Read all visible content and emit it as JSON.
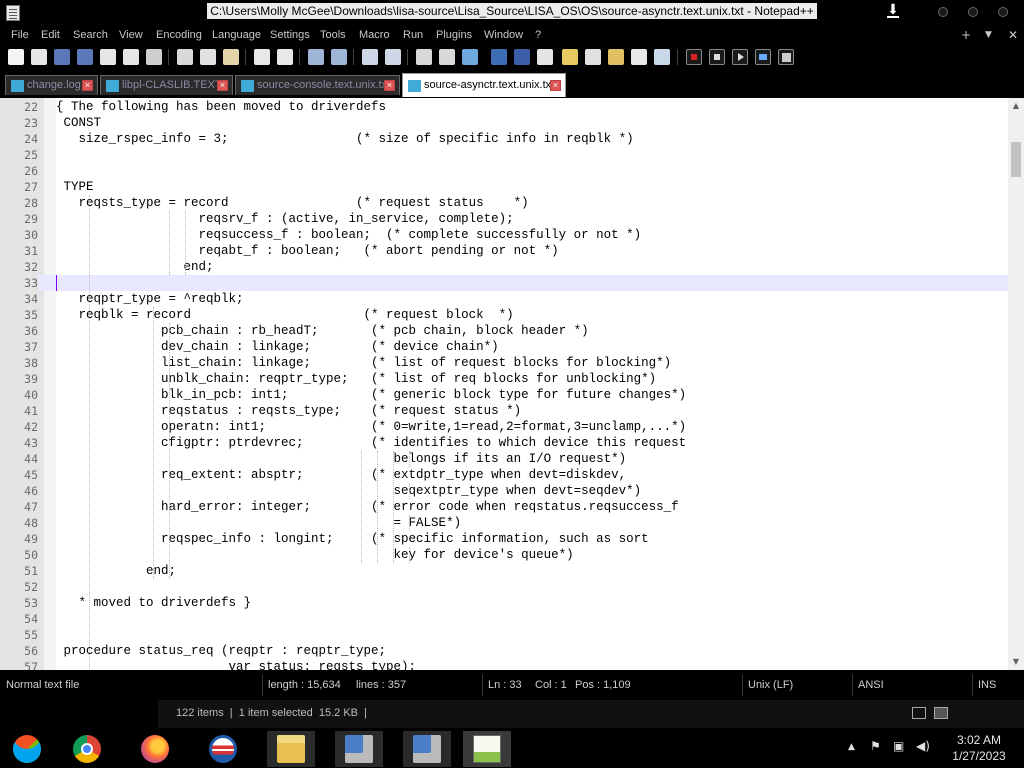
{
  "window": {
    "title": "C:\\Users\\Molly McGee\\Downloads\\lisa-source\\Lisa_Source\\LISA_OS\\OS\\source-asynctr.text.unix.txt - Notepad++"
  },
  "menu": [
    "File",
    "Edit",
    "Search",
    "View",
    "Encoding",
    "Language",
    "Settings",
    "Tools",
    "Macro",
    "Run",
    "Plugins",
    "Window",
    "?"
  ],
  "menu_right": [
    "+",
    "▼",
    "✕"
  ],
  "toolbar_icons": [
    "new-file-icon",
    "open-file-icon",
    "save-icon",
    "save-all-icon",
    "close-icon",
    "close-all-icon",
    "print-icon",
    "cut-icon",
    "copy-icon",
    "paste-icon",
    "undo-icon",
    "redo-icon",
    "find-icon",
    "replace-icon",
    "zoom-in-icon",
    "zoom-out-icon",
    "sync-vertical-icon",
    "sync-horizontal-icon",
    "word-wrap-icon",
    "show-all-chars-icon",
    "indent-guide-icon",
    "language-icon",
    "doc-map-icon",
    "function-list-icon",
    "folder-workspace-icon",
    "monitoring-icon",
    "record-macro-icon",
    "stop-record-icon",
    "play-macro-icon",
    "run-macro-multiple-icon",
    "save-macro-icon"
  ],
  "tabs": [
    {
      "label": "change.log",
      "active": false
    },
    {
      "label": "libpl-CLASLIB.TEXT",
      "active": false
    },
    {
      "label": "source-console.text.unix.txt",
      "active": false
    },
    {
      "label": "source-asynctr.text.unix.txt",
      "active": true
    }
  ],
  "editor": {
    "current_line": 33,
    "lines": [
      {
        "n": "22",
        "text": "{ The following has been moved to driverdefs"
      },
      {
        "n": "23",
        "text": " CONST"
      },
      {
        "n": "24",
        "text": "   size_rspec_info = 3;                 (* size of specific info in reqblk *)"
      },
      {
        "n": "25",
        "text": ""
      },
      {
        "n": "26",
        "text": ""
      },
      {
        "n": "27",
        "text": " TYPE"
      },
      {
        "n": "28",
        "text": "   reqsts_type = record                 (* request status    *)"
      },
      {
        "n": "29",
        "text": "                   reqsrv_f : (active, in_service, complete);"
      },
      {
        "n": "30",
        "text": "                   reqsuccess_f : boolean;  (* complete successfully or not *)"
      },
      {
        "n": "31",
        "text": "                   reqabt_f : boolean;   (* abort pending or not *)"
      },
      {
        "n": "32",
        "text": "                 end;"
      },
      {
        "n": "33",
        "text": ""
      },
      {
        "n": "34",
        "text": "   reqptr_type = ^reqblk;"
      },
      {
        "n": "35",
        "text": "   reqblk = record                       (* request block  *)"
      },
      {
        "n": "36",
        "text": "              pcb_chain : rb_headT;       (* pcb chain, block header *)"
      },
      {
        "n": "37",
        "text": "              dev_chain : linkage;        (* device chain*)"
      },
      {
        "n": "38",
        "text": "              list_chain: linkage;        (* list of request blocks for blocking*)"
      },
      {
        "n": "39",
        "text": "              unblk_chain: reqptr_type;   (* list of req blocks for unblocking*)"
      },
      {
        "n": "40",
        "text": "              blk_in_pcb: int1;           (* generic block type for future changes*)"
      },
      {
        "n": "41",
        "text": "              reqstatus : reqsts_type;    (* request status *)"
      },
      {
        "n": "42",
        "text": "              operatn: int1;              (* 0=write,1=read,2=format,3=unclamp,...*)"
      },
      {
        "n": "43",
        "text": "              cfigptr: ptrdevrec;         (* identifies to which device this request"
      },
      {
        "n": "44",
        "text": "                                             belongs if its an I/O request*)"
      },
      {
        "n": "45",
        "text": "              req_extent: absptr;         (* extdptr_type when devt=diskdev,"
      },
      {
        "n": "46",
        "text": "                                             seqextptr_type when devt=seqdev*)"
      },
      {
        "n": "47",
        "text": "              hard_error: integer;        (* error code when reqstatus.reqsuccess_f"
      },
      {
        "n": "48",
        "text": "                                             = FALSE*)"
      },
      {
        "n": "49",
        "text": "              reqspec_info : longint;     (* specific information, such as sort"
      },
      {
        "n": "50",
        "text": "                                             key for device's queue*)"
      },
      {
        "n": "51",
        "text": "            end;"
      },
      {
        "n": "52",
        "text": ""
      },
      {
        "n": "53",
        "text": "   * moved to driverdefs }"
      },
      {
        "n": "54",
        "text": ""
      },
      {
        "n": "55",
        "text": ""
      },
      {
        "n": "56",
        "text": " procedure status_req (reqptr : reqptr_type;"
      },
      {
        "n": "57",
        "text": "                       var status: reqsts_type);"
      }
    ]
  },
  "statusbar": {
    "type": "Normal text file",
    "length": "length : 15,634",
    "lines": "lines : 357",
    "ln": "Ln : 33",
    "col": "Col : 1",
    "pos": "Pos : 1,109",
    "eol": "Unix (LF)",
    "encoding": "ANSI",
    "mode": "INS"
  },
  "explorer": {
    "text": "122 items  |  1 item selected  15.2 KB  |"
  },
  "taskbar": {
    "apps": [
      "windows-start-icon",
      "chrome-icon",
      "firefox-icon",
      "obama-logo-icon",
      "file-explorer-icon",
      "network-setup-icon",
      "network-setup-icon",
      "notepad-plus-plus-icon"
    ],
    "tray": [
      "chevron-up-icon",
      "flag-icon",
      "network-icon",
      "volume-icon"
    ],
    "time": "3:02 AM",
    "date": "1/27/2023"
  },
  "colors": {
    "accent_current_line": "#e8e8ff",
    "caret": "#8000ff",
    "tab_text_inactive": "#8a8aa6"
  }
}
